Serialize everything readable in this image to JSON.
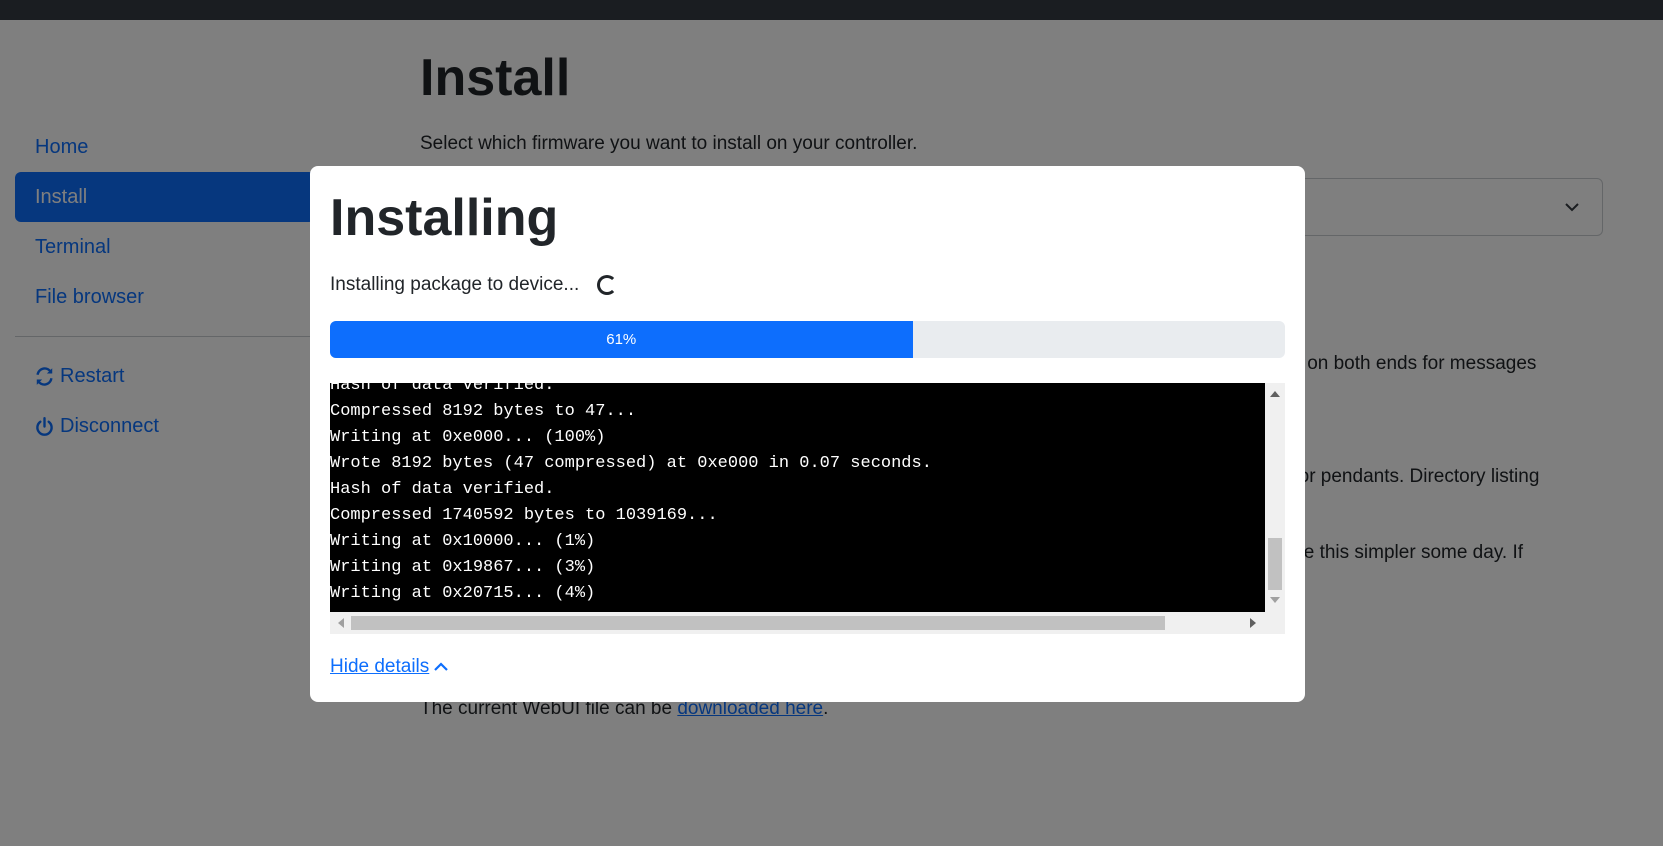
{
  "sidebar": {
    "items": [
      {
        "label": "Home"
      },
      {
        "label": "Install",
        "active": true
      },
      {
        "label": "Terminal"
      },
      {
        "label": "File browser"
      }
    ],
    "actions": [
      {
        "label": "Restart",
        "icon": "refresh-icon"
      },
      {
        "label": "Disconnect",
        "icon": "power-icon"
      }
    ]
  },
  "main": {
    "title": "Install",
    "subtitle": "Select which firmware you want to install on your controller.",
    "background_fragments": [
      "load on both ends for messages",
      "ful for pendants. Directory listing",
      "o make this simpler some day. If"
    ],
    "footer_prefix": "The current WebUI file can be ",
    "footer_link": "downloaded here",
    "footer_suffix": "."
  },
  "modal": {
    "title": "Installing",
    "status": "Installing package to device...",
    "progress_percent": 61,
    "progress_label": "61%",
    "console_lines": [
      "Hash of data verified.",
      "Compressed 8192 bytes to 47...",
      "Writing at 0xe000... (100%)",
      "Wrote 8192 bytes (47 compressed) at 0xe000 in 0.07 seconds.",
      "Hash of data verified.",
      "Compressed 1740592 bytes to 1039169...",
      "Writing at 0x10000... (1%)",
      "Writing at 0x19867... (3%)",
      "Writing at 0x20715... (4%)"
    ],
    "hide_details_label": "Hide details"
  },
  "colors": {
    "accent": "#0d6efd",
    "backdrop": "rgba(0,0,0,0.5)",
    "console_bg": "#000000",
    "console_text": "#ffffff"
  }
}
